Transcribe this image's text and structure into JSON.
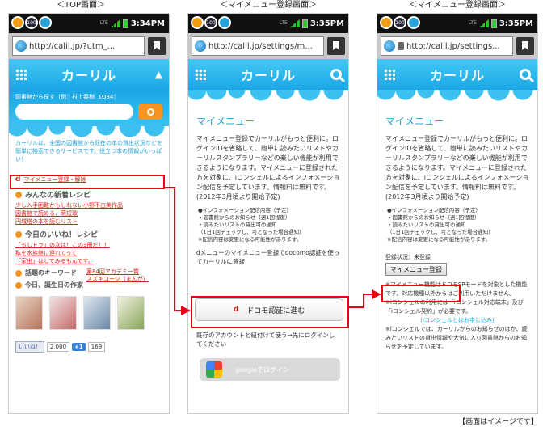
{
  "captions": [
    "＜TOP画面＞",
    "＜マイメニュー登録画面＞",
    "＜マイメニュー登録画面＞"
  ],
  "footer": "【画面はイメージです】",
  "colors": {
    "sky": "#1aa7e6",
    "orange": "#f7931e",
    "red": "#e60012",
    "link_red": "#d9241b",
    "link_blue": "#29a4d8"
  },
  "status_bar": {
    "icons": [
      "notify-icon",
      "100-icon",
      "app-icon"
    ],
    "lte": "LTE",
    "times": [
      "3:34PM",
      "3:35PM",
      "3:35PM"
    ]
  },
  "urls": [
    "http://calil.jp/?utm_...",
    "http://calil.jp/settings/m...",
    "http://calil.jp/settings..."
  ],
  "app_name": "カーリル",
  "top": {
    "search_label": "図書館から探す（例：村上春樹, 1Q84）",
    "intro": "カーリルは、全国の図書館から既在の本の貸出状況などを簡単に検索できるサービスです。役立つ本の情報がいっぱい！",
    "mymenu_link": "マイメニュー登録・解除",
    "docomo_mark": "d",
    "section1": "みんなの新着レシピ",
    "section1_links": [
      "少し入手困難かもしれない小野不由美作品",
      "図書館で読める、萌短歌",
      "円城塔の本を読むリスト"
    ],
    "section2": "今日のいいね！レシピ",
    "section2_links": [
      "「もしドラ」の次は！この3冊だ！！",
      "私を水族館に連れてって",
      "「家出」はしてみるもんです。"
    ],
    "section3": "話題のキーワード",
    "section3_links": [
      "第84回アカデミー賞",
      "スズキコージ（まんが）"
    ],
    "section4": "今日、誕生日の作家",
    "like": "いいね！",
    "like_count": "2,000",
    "plus": "+1",
    "plus_count": "169"
  },
  "reg": {
    "title": "マイメニュー",
    "text": "マイメニュー登録でカーリルがもっと便利に。ログインIDを省略して、簡単に読みたいリストやカーリルスタンプラリーなどの楽しい機能が利用できるようになります。マイメニューに登録された方を対象に、iコンシェルによるインフォメーション配信を予定しています。情報料は無料です。(2012年3月頃より開始予定)",
    "info": [
      "●インフォメーション配信内容（予定）",
      "・図書館からのお知らせ（週1回程度）",
      "・読みたいリストの貸出可の通知",
      "（1日1回チェックし、可となった場合通知）",
      "※配信内容は変更になる可能性があります。"
    ],
    "docomo_text": "dメニューのマイメニュー登録でdocomo認証を使ってカーリルに登録",
    "docomo_button": "ドコモ認証に進む",
    "existing_text": "既存のアカウントと紐付けて使う→先にログインしてください",
    "google_button": "googleでログイン"
  },
  "reg2": {
    "status": "登録状況：未登録",
    "button": "マイメニュー登録",
    "notes": [
      "※マイメニュー機能はドコモSPモードを対象とした機能です。対応機種以外からはご利用いただけません。",
      "※iコンシェルの利用には「iコンシェル対応端末」及び「iコンシェル契約」が必要です。"
    ],
    "note_link": "(iコンシェルとはお申し込み)",
    "note_last": "※iコンシェルでは、カーリルからのお知らせのほか、読みたいリストの貸出情報や大気に入り図書館からのお知らせを予定しています。"
  }
}
